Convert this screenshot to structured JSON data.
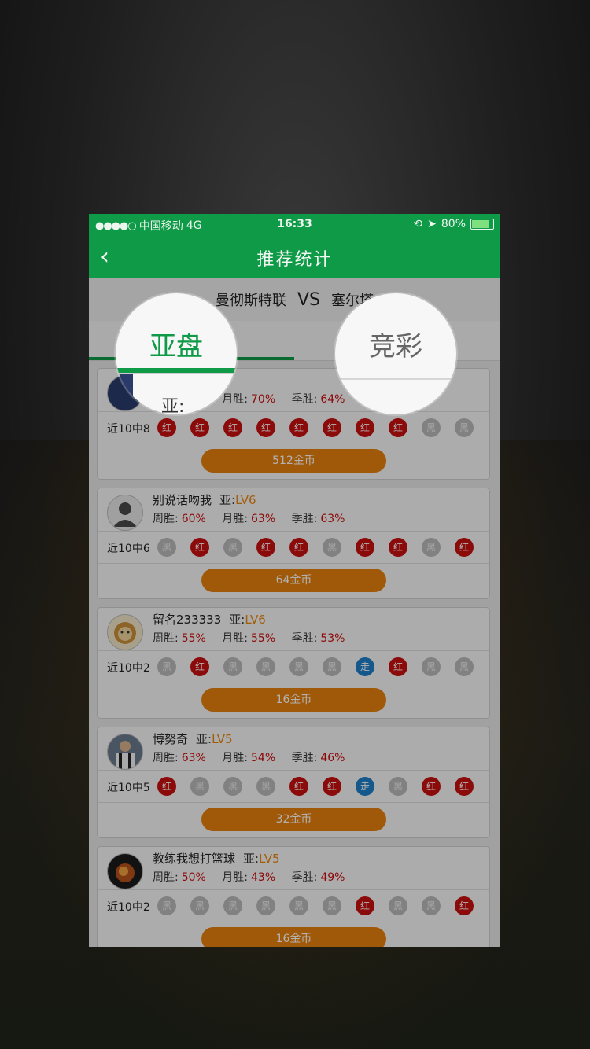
{
  "status_bar": {
    "signal": "●●●●○",
    "carrier": "中国移动",
    "network": "4G",
    "time": "16:33",
    "battery_pct": "80%"
  },
  "nav": {
    "title": "推荐统计"
  },
  "match": {
    "home": "曼彻斯特联",
    "vs": "VS",
    "away": "塞尔塔"
  },
  "tabs": [
    {
      "label": "亚盘"
    },
    {
      "label": "竞彩"
    }
  ],
  "labels": {
    "week": "周胜:",
    "month": "月胜:",
    "season": "季胜:",
    "lv_prefix": "亚:"
  },
  "cards": [
    {
      "name": "",
      "level": "",
      "week": "",
      "month": "70%",
      "season": "64%",
      "recent": "近10中8",
      "results": [
        "红",
        "红",
        "红",
        "红",
        "红",
        "红",
        "红",
        "红",
        "黑",
        "黑"
      ],
      "price": "512金币"
    },
    {
      "name": "别说话吻我",
      "level": "LV6",
      "week": "60%",
      "month": "63%",
      "season": "63%",
      "recent": "近10中6",
      "results": [
        "黑",
        "红",
        "黑",
        "红",
        "红",
        "黑",
        "红",
        "红",
        "黑",
        "红"
      ],
      "price": "64金币"
    },
    {
      "name": "留名233333",
      "level": "LV6",
      "week": "55%",
      "month": "55%",
      "season": "53%",
      "recent": "近10中2",
      "results": [
        "黑",
        "红",
        "黑",
        "黑",
        "黑",
        "黑",
        "走",
        "红",
        "黑",
        "黑"
      ],
      "price": "16金币"
    },
    {
      "name": "博努奇",
      "level": "LV5",
      "week": "63%",
      "month": "54%",
      "season": "46%",
      "recent": "近10中5",
      "results": [
        "红",
        "黑",
        "黑",
        "黑",
        "红",
        "红",
        "走",
        "黑",
        "红",
        "红"
      ],
      "price": "32金币"
    },
    {
      "name": "教练我想打篮球",
      "level": "LV5",
      "week": "50%",
      "month": "43%",
      "season": "49%",
      "recent": "近10中2",
      "results": [
        "黑",
        "黑",
        "黑",
        "黑",
        "黑",
        "黑",
        "红",
        "黑",
        "黑",
        "红"
      ],
      "price": "16金币"
    }
  ],
  "magnifier": {
    "left_partial": "亚:"
  },
  "colors": {
    "brand_green": "#0e9a46",
    "win_red": "#c80f0f",
    "lose_gray": "#b9b9b9",
    "draw_blue": "#1f7fc8",
    "coin_orange": "#e6800e"
  }
}
